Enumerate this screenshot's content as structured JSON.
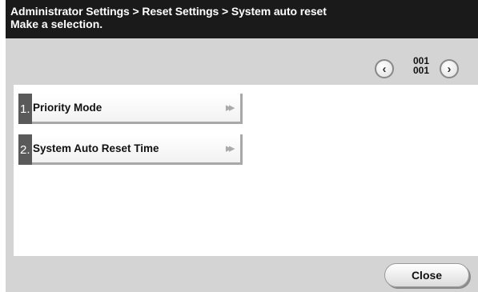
{
  "header": {
    "breadcrumb": "Administrator Settings > Reset Settings > System auto reset",
    "instruction": "Make a selection."
  },
  "pager": {
    "current": "001",
    "total": "001",
    "prev_icon": "chevron-left-icon",
    "next_icon": "chevron-right-icon"
  },
  "menu": {
    "items": [
      {
        "number": "1.",
        "label": "Priority Mode",
        "icon": "double-arrow-right-icon"
      },
      {
        "number": "2.",
        "label": "System Auto Reset Time",
        "icon": "double-arrow-right-icon"
      }
    ]
  },
  "footer": {
    "close_label": "Close"
  },
  "colors": {
    "header_bg": "#1a1a1a",
    "panel_bg": "#d4d4d4",
    "content_bg": "#ffffff",
    "number_tab_bg": "#5a5a5a"
  }
}
